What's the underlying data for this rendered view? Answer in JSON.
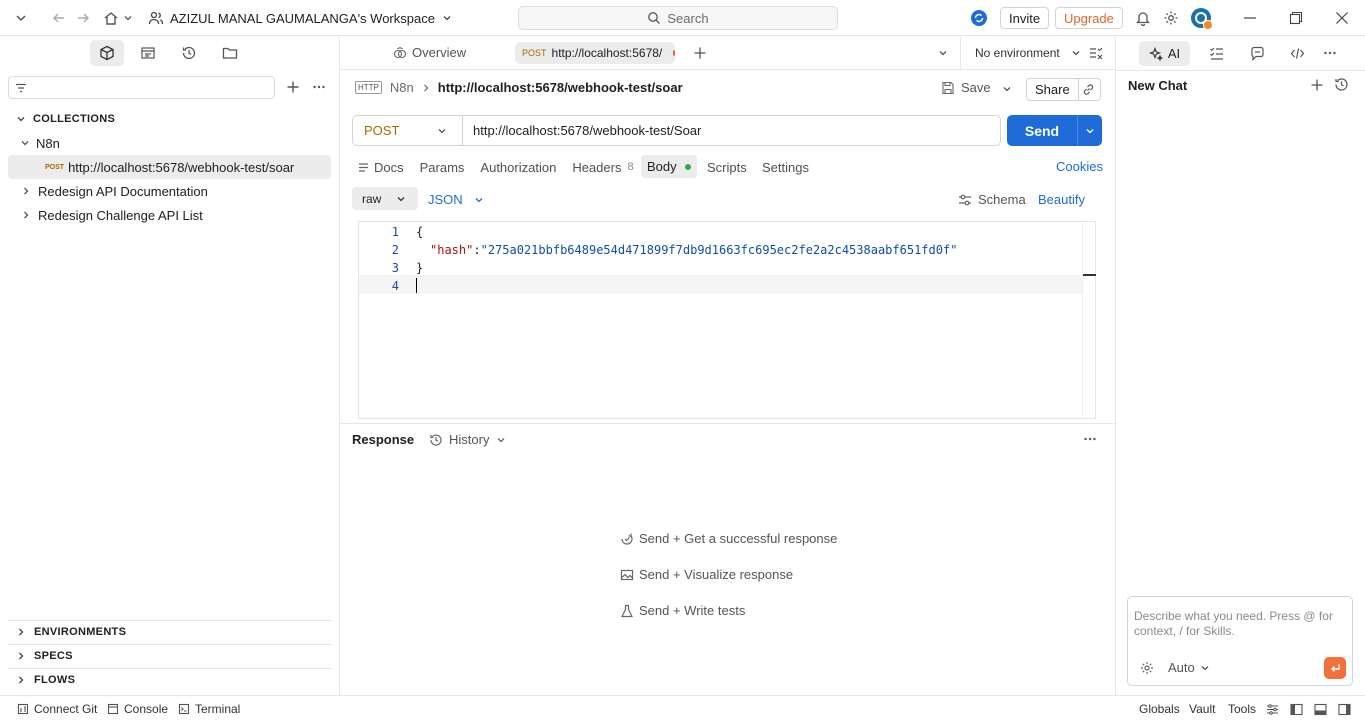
{
  "topbar": {
    "workspace": "AZIZUL MANAL GAUMALANGA's Workspace",
    "search_placeholder": "Search",
    "invite_label": "Invite",
    "upgrade_label": "Upgrade"
  },
  "sidebar": {
    "collections_heading": "COLLECTIONS",
    "tree": {
      "n8n": "N8n",
      "request_method": "POST",
      "request_url": "http://localhost:5678/webhook-test/soar",
      "item2": "Redesign API Documentation",
      "item3": "Redesign Challenge API List"
    },
    "environments": "ENVIRONMENTS",
    "specs": "SPECS",
    "flows": "FLOWS"
  },
  "tabs": {
    "overview": "Overview",
    "active_method": "POST",
    "active_url": "http://localhost:5678/",
    "environment": "No environment"
  },
  "request": {
    "breadcrumb_parent": "N8n",
    "breadcrumb_current": "http://localhost:5678/webhook-test/soar",
    "save_label": "Save",
    "share_label": "Share",
    "method": "POST",
    "url": "http://localhost:5678/webhook-test/Soar",
    "send_label": "Send",
    "tabs": {
      "docs": "Docs",
      "params": "Params",
      "authorization": "Authorization",
      "headers": "Headers",
      "headers_count": "8",
      "body": "Body",
      "scripts": "Scripts",
      "settings": "Settings"
    },
    "cookies_label": "Cookies",
    "body_mode": "raw",
    "body_format": "JSON",
    "schema_label": "Schema",
    "beautify_label": "Beautify",
    "code": {
      "l1": "1",
      "l2": "2",
      "l3": "3",
      "l4": "4",
      "open_brace": "{",
      "key": "\"hash\"",
      "colon": ":",
      "value": "\"275a021bbfb6489e54d471899f7db9d1663fc695ec2fe2a2c4538aabf651fd0f\"",
      "close_brace": "}"
    }
  },
  "response": {
    "title": "Response",
    "history_label": "History",
    "hint1": "Send + Get a successful response",
    "hint2": "Send + Visualize response",
    "hint3": "Send + Write tests"
  },
  "right_panel": {
    "ai_label": "AI",
    "new_chat": "New Chat",
    "chat_placeholder": "Describe what you need. Press @ for context, / for Skills.",
    "mode": "Auto"
  },
  "statusbar": {
    "connect_git": "Connect Git",
    "console": "Console",
    "terminal": "Terminal",
    "globals": "Globals",
    "vault": "Vault",
    "tools": "Tools"
  },
  "colors": {
    "accent": "#1f6bd8",
    "upgrade": "#e0662b",
    "post": "#a46a00",
    "unsaved_dot": "#e8582a",
    "body_dot": "#2fa84f"
  }
}
